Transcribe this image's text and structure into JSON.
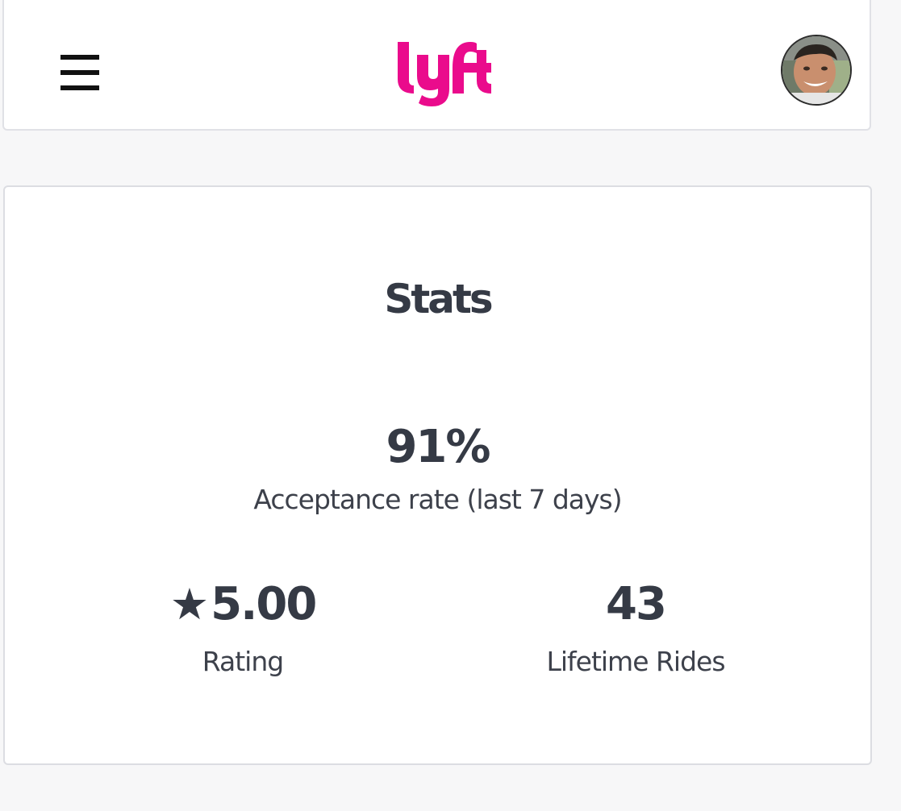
{
  "colors": {
    "brand": "#EA0B8C",
    "text": "#353A45",
    "page_background": "#F7F7F8",
    "card_background": "#FFFFFF"
  },
  "header": {
    "menu_icon": "hamburger-menu-icon",
    "logo": "lyft",
    "avatar_icon": "user-avatar"
  },
  "stats": {
    "title": "Stats",
    "acceptance_rate": {
      "value": "91%",
      "label": "Acceptance rate (last 7 days)"
    },
    "rating": {
      "star": "★",
      "value": "5.00",
      "label": "Rating"
    },
    "lifetime_rides": {
      "value": "43",
      "label": "Lifetime Rides"
    }
  }
}
